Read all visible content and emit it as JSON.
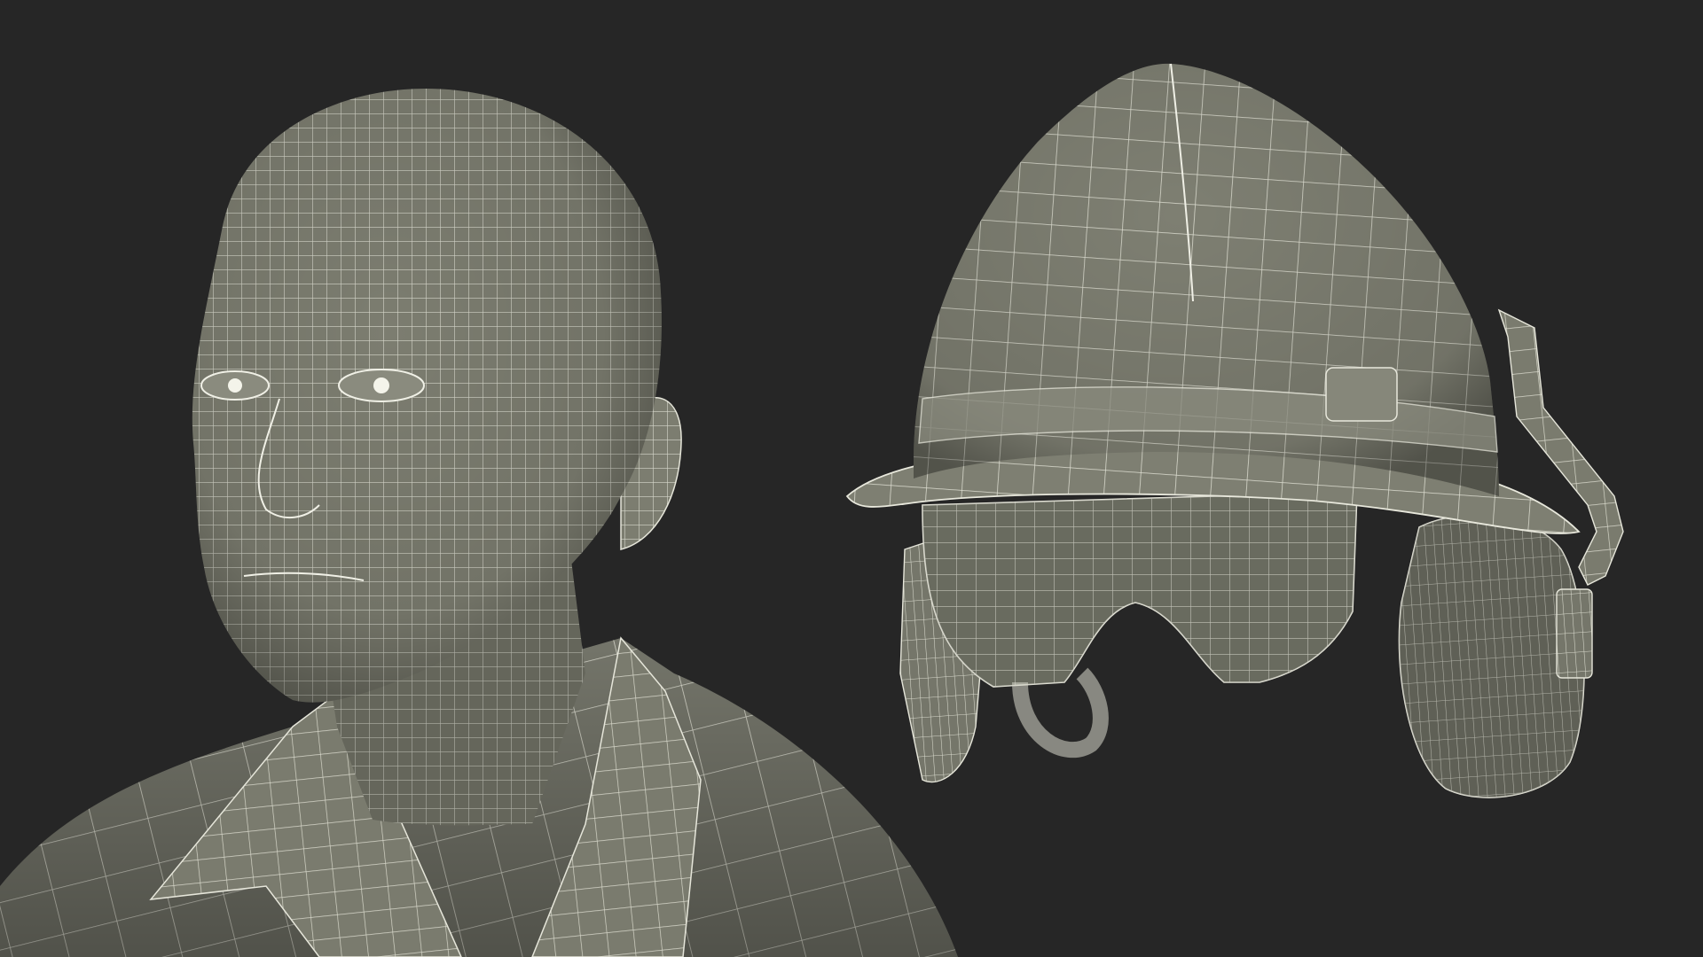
{
  "scene": {
    "background_color": "#262626",
    "mesh_fill_color": "#7c7d70",
    "mesh_shade_color": "#5e5f55",
    "wire_color": "#e8e8dc",
    "subjects": [
      {
        "kind": "wireframe-head-and-shirt",
        "icon": "human-bust-wireframe-icon"
      },
      {
        "kind": "wireframe-hard-hat-with-goggles-and-earmuffs",
        "icon": "hard-hat-wireframe-icon"
      }
    ]
  }
}
